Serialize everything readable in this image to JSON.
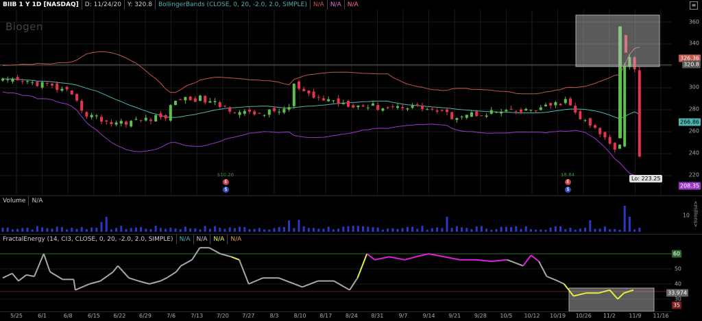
{
  "price_panel": {
    "symbol_label": "BIIB 1 Y 1D [NASDAQ]",
    "date_info": "D: 11/24/20",
    "close_info": "Y: 320.8",
    "study_label": "BollingerBands (CLOSE, 0, 20, -2.0, 2.0, SIMPLE)",
    "na_1": "N/A",
    "na_2": "N/A",
    "na_3": "N/A",
    "watermark": "Biogen",
    "price_ticks": [
      "360",
      "340",
      "320",
      "300",
      "280",
      "260",
      "240",
      "220"
    ],
    "badge_upper": "326.36",
    "badge_last": "320.8",
    "badge_mid": "266.86",
    "badge_lower": "208.35",
    "low_label": "Lo: 223.25",
    "dividend_1": "$10.26",
    "dividend_2": "$8.84",
    "dividend_icon": "$",
    "event_icon": "E"
  },
  "volume_panel": {
    "label": "Volume",
    "na": "N/A",
    "ticks": [
      "10"
    ],
    "unit_label": "<millions>"
  },
  "fe_panel": {
    "label": "FractalEnergy (14, CI3, CLOSE, 0, 20, -2.0, 2.0, SIMPLE)",
    "na_1": "N/A",
    "na_2": "N/A",
    "na_3": "N/A",
    "na_4": "N/A",
    "ticks": [
      "60",
      "50",
      "40",
      "30"
    ],
    "badge_60": "60",
    "badge_val": "33.974",
    "badge_35": "35"
  },
  "x_axis": {
    "labels": [
      "5/25",
      "6/1",
      "6/8",
      "6/15",
      "6/22",
      "6/29",
      "7/6",
      "7/13",
      "7/20",
      "7/27",
      "8/3",
      "8/10",
      "8/17",
      "8/24",
      "8/31",
      "9/7",
      "9/14",
      "9/21",
      "9/28",
      "10/5",
      "10/12",
      "10/19",
      "10/26",
      "11/2",
      "11/9",
      "11/16"
    ]
  },
  "colors": {
    "up": "#5cc04a",
    "down": "#e8334f",
    "upper_band": "#c0584c",
    "mid_band": "#4fb4b4",
    "lower_band": "#9a38c8",
    "volume": "#2a3ac8",
    "fe_gray": "#a8a8a8",
    "fe_yellow": "#e4f040",
    "fe_magenta": "#e020e0"
  }
}
